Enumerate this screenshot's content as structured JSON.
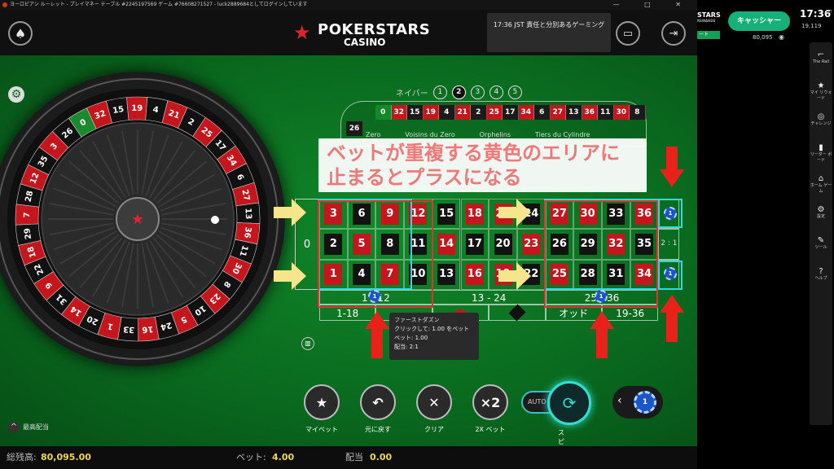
{
  "window": {
    "title": "ヨーロピアン ルーレット - プレイマネー テーブル #2245197569 ゲーム #76608271527 - luck2889684としてログインしています",
    "controls": "— □ ✕"
  },
  "header": {
    "home_icon": "spade-icon",
    "logo_line1": "POKERSTARS",
    "logo_line2": "CASINO",
    "message": "17:36 JST 責任と分別あるゲーミング",
    "icons": [
      "cash-icon",
      "exit-icon"
    ]
  },
  "neighbours": {
    "label": "ネイバー",
    "options": [
      "1",
      "2",
      "3",
      "4",
      "5"
    ],
    "selected": "2"
  },
  "racetrack": {
    "top_numbers": [
      {
        "n": "0",
        "c": "green"
      },
      {
        "n": "32",
        "c": "red"
      },
      {
        "n": "15",
        "c": "black"
      },
      {
        "n": "19",
        "c": "red"
      },
      {
        "n": "4",
        "c": "black"
      },
      {
        "n": "21",
        "c": "red"
      },
      {
        "n": "2",
        "c": "black"
      },
      {
        "n": "25",
        "c": "red"
      },
      {
        "n": "17",
        "c": "black"
      },
      {
        "n": "34",
        "c": "red"
      },
      {
        "n": "6",
        "c": "black"
      },
      {
        "n": "27",
        "c": "red"
      },
      {
        "n": "13",
        "c": "black"
      },
      {
        "n": "36",
        "c": "red"
      },
      {
        "n": "11",
        "c": "black"
      },
      {
        "n": "30",
        "c": "red"
      },
      {
        "n": "8",
        "c": "black"
      }
    ],
    "left_number": "26",
    "sections": [
      "Zero",
      "Voisins du Zero",
      "Orphelins",
      "Tiers du Cylindre"
    ]
  },
  "annotation": {
    "line1": "ベットが重複する黄色のエリアに",
    "line2": "止まるとプラスになる"
  },
  "betting_grid": {
    "zero": "0",
    "rows": [
      [
        {
          "n": "3",
          "c": "red"
        },
        {
          "n": "6",
          "c": "black"
        },
        {
          "n": "9",
          "c": "red"
        },
        {
          "n": "12",
          "c": "red"
        },
        {
          "n": "15",
          "c": "black"
        },
        {
          "n": "18",
          "c": "red"
        },
        {
          "n": "21",
          "c": "red"
        },
        {
          "n": "24",
          "c": "black"
        },
        {
          "n": "27",
          "c": "red"
        },
        {
          "n": "30",
          "c": "red"
        },
        {
          "n": "33",
          "c": "black"
        },
        {
          "n": "36",
          "c": "red"
        }
      ],
      [
        {
          "n": "2",
          "c": "black"
        },
        {
          "n": "5",
          "c": "red"
        },
        {
          "n": "8",
          "c": "black"
        },
        {
          "n": "11",
          "c": "black"
        },
        {
          "n": "14",
          "c": "red"
        },
        {
          "n": "17",
          "c": "black"
        },
        {
          "n": "20",
          "c": "black"
        },
        {
          "n": "23",
          "c": "red"
        },
        {
          "n": "26",
          "c": "black"
        },
        {
          "n": "29",
          "c": "black"
        },
        {
          "n": "32",
          "c": "red"
        },
        {
          "n": "35",
          "c": "black"
        }
      ],
      [
        {
          "n": "1",
          "c": "red"
        },
        {
          "n": "4",
          "c": "black"
        },
        {
          "n": "7",
          "c": "red"
        },
        {
          "n": "10",
          "c": "black"
        },
        {
          "n": "13",
          "c": "black"
        },
        {
          "n": "16",
          "c": "red"
        },
        {
          "n": "19",
          "c": "red"
        },
        {
          "n": "22",
          "c": "black"
        },
        {
          "n": "25",
          "c": "red"
        },
        {
          "n": "28",
          "c": "black"
        },
        {
          "n": "31",
          "c": "black"
        },
        {
          "n": "34",
          "c": "red"
        }
      ]
    ],
    "columns": [
      "",
      "2 : 1",
      ""
    ],
    "dozens": [
      "1 - 12",
      "13 - 24",
      "25 - 36"
    ],
    "outside": [
      "1-18",
      "",
      "",
      "",
      "オッド",
      "19-36"
    ],
    "chip_value": "1"
  },
  "tooltip": {
    "title": "ファーストダズン",
    "line1": "クリックして: 1.00 をベット",
    "line2": "ベット: 1.00",
    "line3": "配当: 2:1"
  },
  "controls": [
    {
      "label": "マイベット",
      "icon": "star-icon",
      "glyph": "★"
    },
    {
      "label": "元に戻す",
      "icon": "undo-icon",
      "glyph": "↶"
    },
    {
      "label": "クリア",
      "icon": "clear-icon",
      "glyph": "✕"
    },
    {
      "label": "2X ベット",
      "icon": "double-icon",
      "glyph": "×2"
    }
  ],
  "spin": {
    "auto_label": "AUTO",
    "label": "スピン"
  },
  "chip_selector": {
    "value": "1"
  },
  "wheel_numbers": [
    "0",
    "32",
    "15",
    "19",
    "4",
    "21",
    "2",
    "25",
    "17",
    "34",
    "6",
    "27",
    "13",
    "36",
    "11",
    "30",
    "8",
    "23",
    "10",
    "5",
    "24",
    "16",
    "33",
    "1",
    "20",
    "14",
    "31",
    "9",
    "22",
    "18",
    "29",
    "7",
    "28",
    "12",
    "35",
    "3",
    "26"
  ],
  "max_payout_label": "最高配当",
  "status": {
    "balance_label": "総残高:",
    "balance_value": "80,095.00",
    "bet_label": "ベット:",
    "bet_value": "4.00",
    "payout_label": "配当",
    "payout_value": "0.00"
  },
  "right_panel": {
    "logo": "STARS",
    "logo_sub": "REWARDS",
    "green_tag": "ート",
    "cashier": "キャッシャー",
    "balance": "80,095",
    "time": "17:36",
    "tz": "JST",
    "count": "19,119",
    "side_items": [
      {
        "label": "The Rail",
        "icon": "rail-icon",
        "glyph": "⌐"
      },
      {
        "label": "マイ リウォード",
        "icon": "reward-icon",
        "glyph": "★"
      },
      {
        "label": "チャレンジ",
        "icon": "challenge-icon",
        "glyph": "◎"
      },
      {
        "label": "リーダー ボード",
        "icon": "leaderboard-icon",
        "glyph": "▮"
      },
      {
        "label": "ホーム ゲーム",
        "icon": "home-icon",
        "glyph": "⌂"
      },
      {
        "label": "設定",
        "icon": "settings-icon",
        "glyph": "⚙"
      },
      {
        "label": "ツール",
        "icon": "tools-icon",
        "glyph": "✎"
      },
      {
        "label": "ヘルプ",
        "icon": "help-icon",
        "glyph": "?"
      }
    ]
  }
}
